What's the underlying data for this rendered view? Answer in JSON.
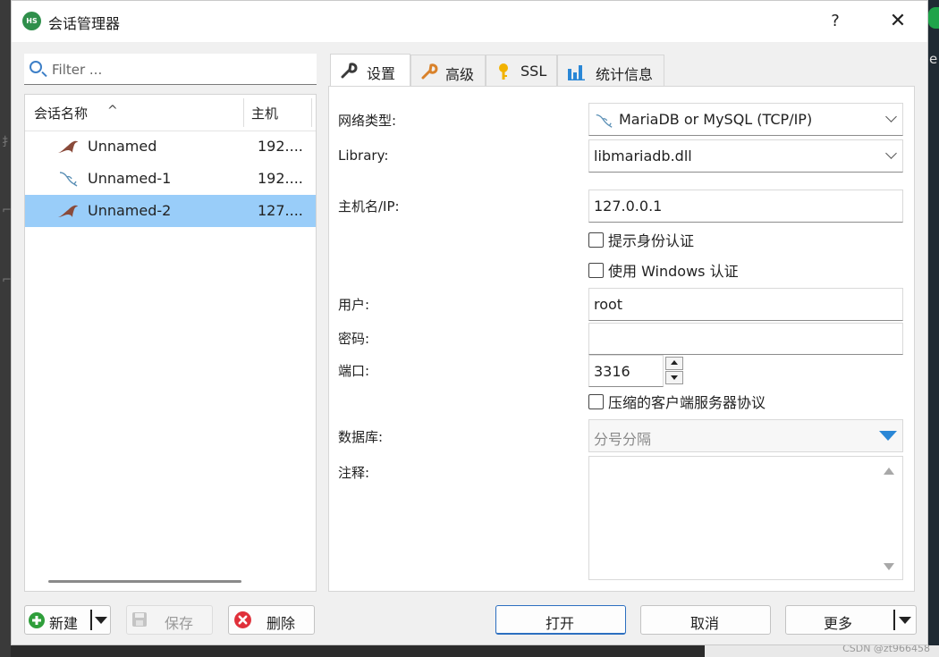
{
  "window": {
    "title": "会话管理器",
    "app_icon_text": "HS",
    "help_label": "?",
    "close_label": "✕"
  },
  "filter": {
    "placeholder": "Filter ..."
  },
  "session_list": {
    "columns": {
      "name": "会话名称",
      "sort_indicator": "^",
      "host": "主机"
    },
    "rows": [
      {
        "name": "Unnamed",
        "host": "192....",
        "icon": "mariadb-seal-icon",
        "selected": false
      },
      {
        "name": "Unnamed-1",
        "host": "192....",
        "icon": "mysql-dolphin-icon",
        "selected": false
      },
      {
        "name": "Unnamed-2",
        "host": "127....",
        "icon": "mariadb-seal-icon",
        "selected": true
      }
    ]
  },
  "tabs": [
    {
      "label": "设置",
      "icon": "wrench-icon",
      "active": true
    },
    {
      "label": "高级",
      "icon": "wrench-orange-icon",
      "active": false
    },
    {
      "label": "SSL",
      "icon": "key-icon",
      "active": false
    },
    {
      "label": "统计信息",
      "icon": "bar-chart-icon",
      "active": false
    }
  ],
  "settings": {
    "network_type_label": "网络类型:",
    "network_type_value": "MariaDB or MySQL (TCP/IP)",
    "library_label": "Library:",
    "library_value": "libmariadb.dll",
    "host_label": "主机名/IP:",
    "host_value": "127.0.0.1",
    "prompt_auth_label": "提示身份认证",
    "windows_auth_label": "使用 Windows 认证",
    "user_label": "用户:",
    "user_value": "root",
    "password_label": "密码:",
    "password_value": "",
    "port_label": "端口:",
    "port_value": "3316",
    "compress_label": "压缩的客户端服务器协议",
    "database_label": "数据库:",
    "database_placeholder": "分号分隔",
    "comment_label": "注释:",
    "comment_value": ""
  },
  "buttons": {
    "new": "新建",
    "save": "保存",
    "delete": "删除",
    "open": "打开",
    "cancel": "取消",
    "more": "更多"
  },
  "colors": {
    "selection": "#99cdf9",
    "accent": "#2a87d6",
    "add_green": "#2e9e3a",
    "delete_red": "#e0303a"
  },
  "watermark": "CSDN @zt966458"
}
